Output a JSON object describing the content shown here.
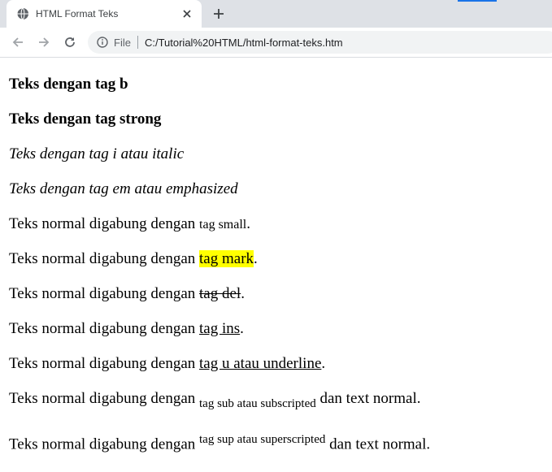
{
  "browser": {
    "tab_title": "HTML Format Teks",
    "omnibox_scheme": "File",
    "url": "C:/Tutorial%20HTML/html-format-teks.htm"
  },
  "content": {
    "line1": "Teks dengan tag b",
    "line2": "Teks dengan tag strong",
    "line3": "Teks dengan tag i atau italic",
    "line4": "Teks dengan tag em atau emphasized",
    "normal_prefix": "Teks normal digabung dengan ",
    "small_text": "tag small",
    "mark_text": "tag mark",
    "del_text": "tag del",
    "ins_text": "tag ins",
    "u_text": "tag u atau underline",
    "sub_text": "tag sub atau subscripted",
    "sup_text": "tag sup atau superscripted",
    "suffix_text": " dan text normal.",
    "period": "."
  },
  "colors": {
    "tabstrip": "#dee1e6",
    "mark": "#ffff00",
    "accent": "#1a73e8"
  },
  "icons": {
    "favicon": "globe-icon",
    "close": "close-icon",
    "newtab": "plus-icon",
    "back": "arrow-left-icon",
    "forward": "arrow-right-icon",
    "reload": "reload-icon",
    "info": "info-icon"
  }
}
